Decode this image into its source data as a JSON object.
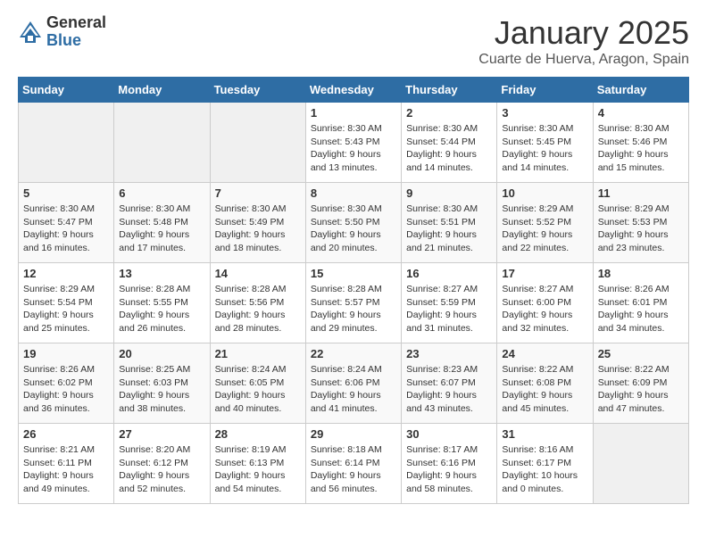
{
  "logo": {
    "general": "General",
    "blue": "Blue"
  },
  "title": "January 2025",
  "location": "Cuarte de Huerva, Aragon, Spain",
  "days_of_week": [
    "Sunday",
    "Monday",
    "Tuesday",
    "Wednesday",
    "Thursday",
    "Friday",
    "Saturday"
  ],
  "weeks": [
    [
      {
        "num": "",
        "detail": ""
      },
      {
        "num": "",
        "detail": ""
      },
      {
        "num": "",
        "detail": ""
      },
      {
        "num": "1",
        "detail": "Sunrise: 8:30 AM\nSunset: 5:43 PM\nDaylight: 9 hours and 13 minutes."
      },
      {
        "num": "2",
        "detail": "Sunrise: 8:30 AM\nSunset: 5:44 PM\nDaylight: 9 hours and 14 minutes."
      },
      {
        "num": "3",
        "detail": "Sunrise: 8:30 AM\nSunset: 5:45 PM\nDaylight: 9 hours and 14 minutes."
      },
      {
        "num": "4",
        "detail": "Sunrise: 8:30 AM\nSunset: 5:46 PM\nDaylight: 9 hours and 15 minutes."
      }
    ],
    [
      {
        "num": "5",
        "detail": "Sunrise: 8:30 AM\nSunset: 5:47 PM\nDaylight: 9 hours and 16 minutes."
      },
      {
        "num": "6",
        "detail": "Sunrise: 8:30 AM\nSunset: 5:48 PM\nDaylight: 9 hours and 17 minutes."
      },
      {
        "num": "7",
        "detail": "Sunrise: 8:30 AM\nSunset: 5:49 PM\nDaylight: 9 hours and 18 minutes."
      },
      {
        "num": "8",
        "detail": "Sunrise: 8:30 AM\nSunset: 5:50 PM\nDaylight: 9 hours and 20 minutes."
      },
      {
        "num": "9",
        "detail": "Sunrise: 8:30 AM\nSunset: 5:51 PM\nDaylight: 9 hours and 21 minutes."
      },
      {
        "num": "10",
        "detail": "Sunrise: 8:29 AM\nSunset: 5:52 PM\nDaylight: 9 hours and 22 minutes."
      },
      {
        "num": "11",
        "detail": "Sunrise: 8:29 AM\nSunset: 5:53 PM\nDaylight: 9 hours and 23 minutes."
      }
    ],
    [
      {
        "num": "12",
        "detail": "Sunrise: 8:29 AM\nSunset: 5:54 PM\nDaylight: 9 hours and 25 minutes."
      },
      {
        "num": "13",
        "detail": "Sunrise: 8:28 AM\nSunset: 5:55 PM\nDaylight: 9 hours and 26 minutes."
      },
      {
        "num": "14",
        "detail": "Sunrise: 8:28 AM\nSunset: 5:56 PM\nDaylight: 9 hours and 28 minutes."
      },
      {
        "num": "15",
        "detail": "Sunrise: 8:28 AM\nSunset: 5:57 PM\nDaylight: 9 hours and 29 minutes."
      },
      {
        "num": "16",
        "detail": "Sunrise: 8:27 AM\nSunset: 5:59 PM\nDaylight: 9 hours and 31 minutes."
      },
      {
        "num": "17",
        "detail": "Sunrise: 8:27 AM\nSunset: 6:00 PM\nDaylight: 9 hours and 32 minutes."
      },
      {
        "num": "18",
        "detail": "Sunrise: 8:26 AM\nSunset: 6:01 PM\nDaylight: 9 hours and 34 minutes."
      }
    ],
    [
      {
        "num": "19",
        "detail": "Sunrise: 8:26 AM\nSunset: 6:02 PM\nDaylight: 9 hours and 36 minutes."
      },
      {
        "num": "20",
        "detail": "Sunrise: 8:25 AM\nSunset: 6:03 PM\nDaylight: 9 hours and 38 minutes."
      },
      {
        "num": "21",
        "detail": "Sunrise: 8:24 AM\nSunset: 6:05 PM\nDaylight: 9 hours and 40 minutes."
      },
      {
        "num": "22",
        "detail": "Sunrise: 8:24 AM\nSunset: 6:06 PM\nDaylight: 9 hours and 41 minutes."
      },
      {
        "num": "23",
        "detail": "Sunrise: 8:23 AM\nSunset: 6:07 PM\nDaylight: 9 hours and 43 minutes."
      },
      {
        "num": "24",
        "detail": "Sunrise: 8:22 AM\nSunset: 6:08 PM\nDaylight: 9 hours and 45 minutes."
      },
      {
        "num": "25",
        "detail": "Sunrise: 8:22 AM\nSunset: 6:09 PM\nDaylight: 9 hours and 47 minutes."
      }
    ],
    [
      {
        "num": "26",
        "detail": "Sunrise: 8:21 AM\nSunset: 6:11 PM\nDaylight: 9 hours and 49 minutes."
      },
      {
        "num": "27",
        "detail": "Sunrise: 8:20 AM\nSunset: 6:12 PM\nDaylight: 9 hours and 52 minutes."
      },
      {
        "num": "28",
        "detail": "Sunrise: 8:19 AM\nSunset: 6:13 PM\nDaylight: 9 hours and 54 minutes."
      },
      {
        "num": "29",
        "detail": "Sunrise: 8:18 AM\nSunset: 6:14 PM\nDaylight: 9 hours and 56 minutes."
      },
      {
        "num": "30",
        "detail": "Sunrise: 8:17 AM\nSunset: 6:16 PM\nDaylight: 9 hours and 58 minutes."
      },
      {
        "num": "31",
        "detail": "Sunrise: 8:16 AM\nSunset: 6:17 PM\nDaylight: 10 hours and 0 minutes."
      },
      {
        "num": "",
        "detail": ""
      }
    ]
  ]
}
